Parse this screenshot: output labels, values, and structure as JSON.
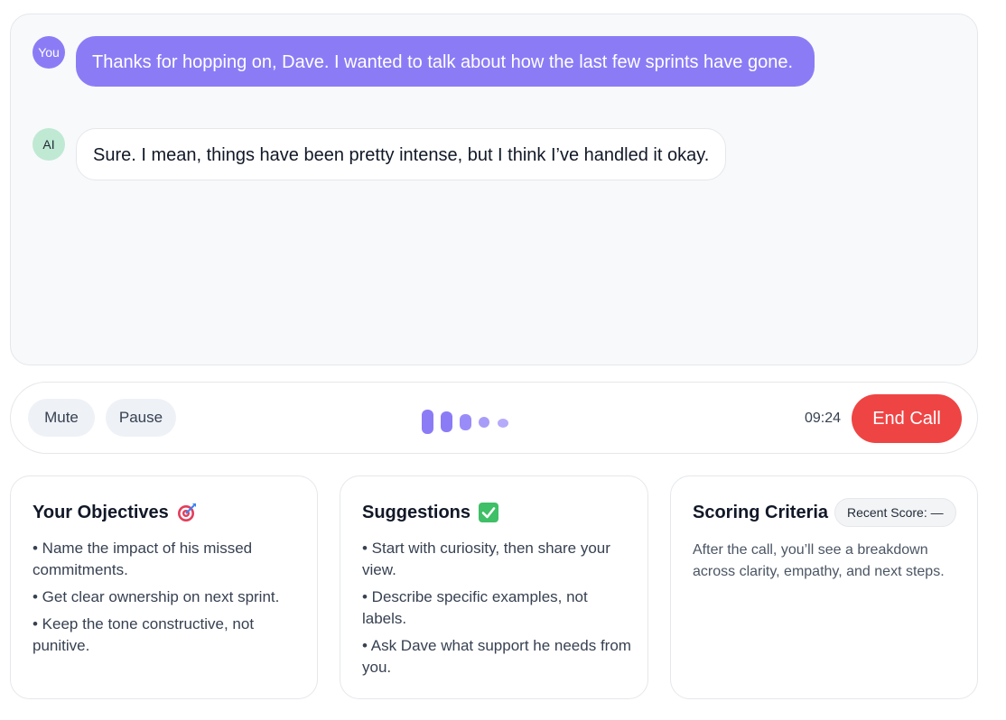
{
  "chat": {
    "messages": [
      {
        "speaker": "You",
        "text": "Thanks for hopping on, Dave. I wanted to talk about how the last few sprints have gone."
      },
      {
        "speaker": "AI",
        "text": "Sure. I mean, things have been pretty intense, but I think I’ve handled it okay."
      }
    ]
  },
  "controls": {
    "mute_label": "Mute",
    "pause_label": "Pause",
    "timer": "09:24",
    "end_call_label": "End Call",
    "accent_color": "#8b7cf6",
    "end_call_color": "#ef4444"
  },
  "panels": {
    "objectives": {
      "title": "Your Objectives",
      "icon": "target-icon",
      "items": [
        "• Name the impact of his missed commitments.",
        "• Get clear ownership on next sprint.",
        "• Keep the tone constructive, not punitive."
      ]
    },
    "suggestions": {
      "title": "Suggestions",
      "icon": "check-mark-icon",
      "items": [
        "• Start with curiosity, then share your view.",
        "• Describe specific examples, not labels.",
        "• Ask Dave what support he needs from you."
      ]
    },
    "scoring": {
      "title": "Scoring Criteria",
      "badge": "Recent Score: —",
      "description": "After the call, you’ll see a breakdown across clarity, empathy, and next steps."
    }
  }
}
